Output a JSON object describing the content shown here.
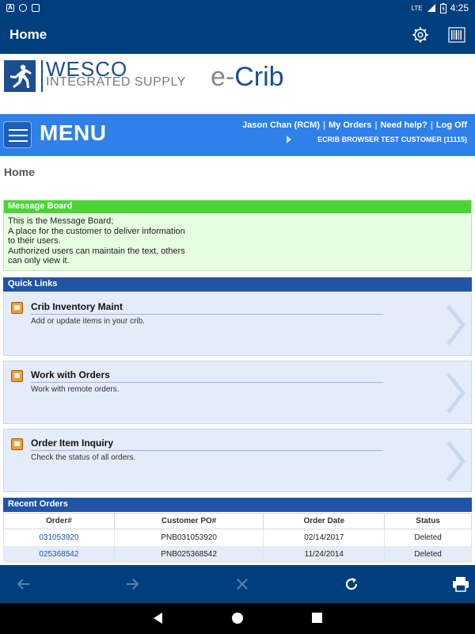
{
  "statusbar": {
    "network": "LTE",
    "time": "4:25"
  },
  "appbar": {
    "title": "Home",
    "settings_icon": "gear-icon",
    "scan_icon": "barcode-icon"
  },
  "brand": {
    "company": "WESCO",
    "subtitle": "INTEGRATED SUPPLY",
    "product_prefix": "e-",
    "product_name": "Crib"
  },
  "menubar": {
    "label": "MENU",
    "user": "Jason Chan (RCM)",
    "links": [
      "My Orders",
      "Need help?",
      "Log Off"
    ],
    "customer": "ECRIB BROWSER TEST CUSTOMER (11115)"
  },
  "page": {
    "title": "Home"
  },
  "message_board": {
    "header": "Message Board",
    "lines": [
      "This is the Message Board;",
      "A place for the customer to deliver information",
      "to their users.",
      "Authorized users can maintain the text, others",
      "can only view it."
    ]
  },
  "quick_links": {
    "header": "Quick Links",
    "items": [
      {
        "title": "Crib Inventory Maint",
        "desc": "Add or update items in your crib."
      },
      {
        "title": "Work with Orders",
        "desc": "Work with remote orders."
      },
      {
        "title": "Order Item Inquiry",
        "desc": "Check the status of all orders."
      }
    ]
  },
  "recent_orders": {
    "header": "Recent Orders",
    "columns": [
      "Order#",
      "Customer PO#",
      "Order Date",
      "Status"
    ],
    "rows": [
      [
        "031053920",
        "PNB031053920",
        "02/14/2017",
        "Deleted"
      ],
      [
        "025368542",
        "PNB025368542",
        "11/24/2014",
        "Deleted"
      ]
    ]
  },
  "colors": {
    "primary": "#003f7d",
    "menu": "#2f80e8",
    "message_header": "#4cd437",
    "section_header": "#1f55a4"
  }
}
